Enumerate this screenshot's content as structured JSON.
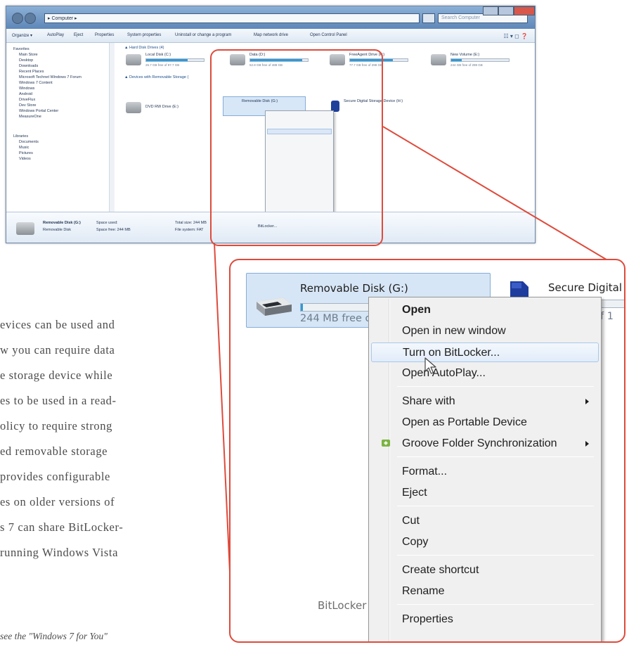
{
  "thumb": {
    "address": "▸ Computer ▸",
    "search_placeholder": "Search Computer",
    "toolbar": [
      "Organize ▾",
      "AutoPlay",
      "Eject",
      "Properties",
      "System properties",
      "Uninstall or change a program",
      "Map network drive",
      "Open Control Panel"
    ],
    "favorites": [
      "Favorites",
      "Main Store",
      "Desktop",
      "Downloads",
      "Recent Places",
      "Microsoft Technet Windows 7 Forum",
      "Windows 7 Content",
      "Windows",
      "Android",
      "DriveFlux",
      "Dev Store",
      "Windows Portal Center",
      "MeasureOne"
    ],
    "libraries": [
      "Libraries",
      "Documents",
      "Music",
      "Pictures",
      "Videos"
    ],
    "group_hdd": "▲ Hard Disk Drives (4)",
    "group_removable": "▲ Devices with Removable Storage (",
    "drives": [
      {
        "name": "Local Disk (C:)",
        "free": "26.7 GB free of 97.7 GB",
        "fill": 0.72
      },
      {
        "name": "Data (D:)",
        "free": "52.8 GB free of 488 GB",
        "fill": 0.9
      },
      {
        "name": "FreeAgent Drive (F:)",
        "free": "77.7 GB free of 298 GB",
        "fill": 0.74
      },
      {
        "name": "New Volume (E:)",
        "free": "244 GB free of 298 GB",
        "fill": 0.18
      }
    ],
    "dvd": "DVD RW Drive (E:)",
    "removable_small": "Removable Disk (G:)",
    "sd_small": "Secure Digital Storage Device (H:)",
    "menu": [
      "Open",
      "Open in new window",
      "Turn on BitLocker...",
      "Open AutoPlay...",
      "Share with",
      "Open as Portable Device",
      "Groove Folder Synchronization",
      "Format...",
      "Eject",
      "Cut",
      "Copy",
      "Create shortcut",
      "Rename",
      "Properties"
    ],
    "details": {
      "name": "Removable Disk (G:)",
      "type": "Removable Disk",
      "space_used": "Space used:",
      "space_free": "Space free: 244 MB",
      "total": "Total size: 244 MB",
      "fs": "File system: FAT",
      "bitlocker": "BitLocker..."
    }
  },
  "body_lines": [
    "evices can be used and",
    "w you can require data",
    "e storage device while",
    "es to be used in a read-",
    "olicy to require strong",
    "ed removable storage",
    "provides configurable",
    "es on older versions of",
    "s 7 can share BitLocker-",
    "running Windows Vista"
  ],
  "footnote": "see the \"Windows 7 for You\"",
  "zoom": {
    "removable_name": "Removable Disk (G:)",
    "removable_free": "244 MB free o",
    "removable_fill": 0.01,
    "sd_name": "Secure Digital S",
    "sd_free": "f 1",
    "status": "BitLocker",
    "menu": [
      {
        "label": "Open",
        "bold": true
      },
      {
        "label": "Open in new window"
      },
      {
        "label": "Turn on BitLocker...",
        "hover": true
      },
      {
        "label": "Open AutoPlay..."
      },
      {
        "label": "Share with",
        "submenu": true
      },
      {
        "label": "Open as Portable Device"
      },
      {
        "label": "Groove Folder Synchronization",
        "submenu": true,
        "icon": "groove-icon"
      },
      {
        "label": "Format..."
      },
      {
        "label": "Eject"
      },
      {
        "label": "Cut"
      },
      {
        "label": "Copy"
      },
      {
        "label": "Create shortcut"
      },
      {
        "label": "Rename"
      },
      {
        "label": "Properties"
      }
    ]
  },
  "colors": {
    "accent_red": "#de4b3c",
    "selection_blue": "#d7e6f6",
    "bar_blue": "#2d9ad9"
  }
}
